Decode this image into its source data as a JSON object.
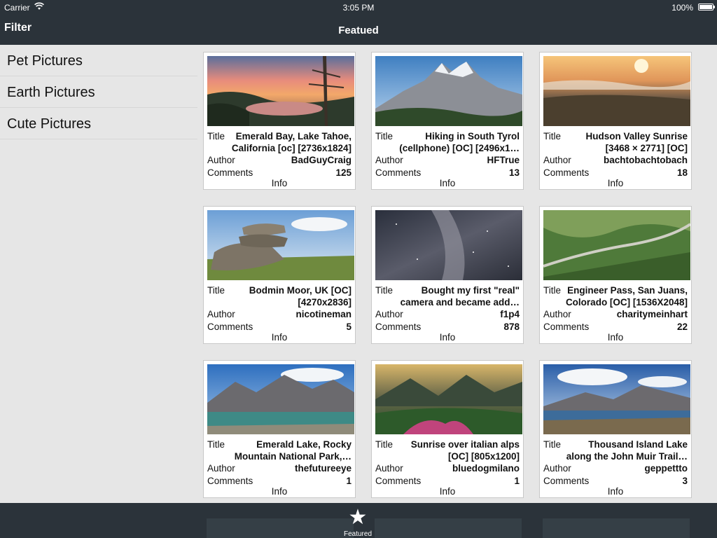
{
  "status_bar": {
    "carrier": "Carrier",
    "time": "3:05 PM",
    "battery": "100%"
  },
  "nav": {
    "left_button": "Filter",
    "title": "Featued"
  },
  "sidebar": {
    "items": [
      {
        "label": "Pet Pictures"
      },
      {
        "label": "Earth Pictures"
      },
      {
        "label": "Cute Pictures"
      }
    ]
  },
  "labels": {
    "title": "Title",
    "author": "Author",
    "comments": "Comments",
    "info": "Info"
  },
  "cards": [
    {
      "title": "Emerald Bay, Lake Tahoe, California [oc] [2736x1824]",
      "author": "BadGuyCraig",
      "comments": "125"
    },
    {
      "title": "Hiking in South Tyrol (cellphone) [OC] [2496x1…",
      "author": "HFTrue",
      "comments": "13"
    },
    {
      "title": "Hudson Valley Sunrise [3468 × 2771] [OC]",
      "author": "bachtobachtobach",
      "comments": "18"
    },
    {
      "title": "Bodmin Moor, UK [OC] [4270x2836]",
      "author": "nicotineman",
      "comments": "5"
    },
    {
      "title": "Bought my first \"real\" camera and became add…",
      "author": "f1p4",
      "comments": "878"
    },
    {
      "title": "Engineer Pass, San Juans, Colorado [OC] [1536X2048]",
      "author": "charitymeinhart",
      "comments": "22"
    },
    {
      "title": "Emerald Lake, Rocky Mountain National Park,…",
      "author": "thefutureeye",
      "comments": "1"
    },
    {
      "title": "Sunrise over italian alps [OC] [805x1200]",
      "author": "bluedogmilano",
      "comments": "1"
    },
    {
      "title": "Thousand Island Lake along the John Muir Trail…",
      "author": "geppettto",
      "comments": "3"
    }
  ],
  "tab_bar": {
    "items": [
      {
        "label": "Featured",
        "icon": "star-icon"
      }
    ]
  },
  "colors": {
    "bar_bg": "#2b333a",
    "content_bg": "#e6e6e6",
    "card_bg": "#ffffff"
  }
}
